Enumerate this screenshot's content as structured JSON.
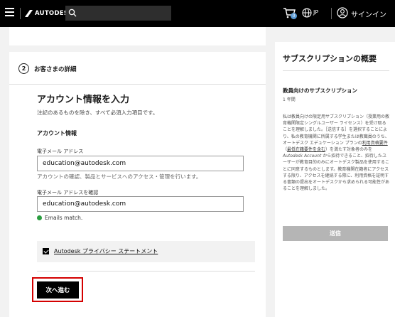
{
  "header": {
    "logo_text": "AUTODESK",
    "cart_count": "0",
    "language": "JP",
    "signin_label": "サインイン"
  },
  "step": {
    "number": "2",
    "label": "お客さまの詳細"
  },
  "account": {
    "title": "アカウント情報を入力",
    "subtitle": "注記のあるものを除き、すべて必須入力項目です。",
    "section_label": "アカウント情報",
    "email_label": "電子メール アドレス",
    "email_value": "education@autodesk.com",
    "email_hint": "アカウントの確認、製品とサービスへのアクセス・管理を行います。",
    "confirm_label": "電子メール アドレスを確認",
    "confirm_value": "education@autodesk.com",
    "match_text": "Emails match.",
    "privacy_link": "Autodesk プライバシー ステートメント",
    "next_button": "次へ進む"
  },
  "summary": {
    "title": "サブスクリプションの概要",
    "subtitle": "教員向けのサブスクリプション",
    "period": "1 年間",
    "body_1": "私は教員向けの限定用サブスクリプション（授業用の教育機関限定シングルユーザー ライセンス）を受け取ることを理解しました。［送信する］を選択することにより、私の教育機関に所属する学生または教職員のうち、オートデスク エデュケーション プランの",
    "body_link_1": "利用資格要件",
    "body_2": "（",
    "body_link_2": "最低在籍要件を含む",
    "body_3": "）を満たす対象者のみを ",
    "body_italic": "Autodesk Account",
    "body_4": " から招待できること、招待したユーザーが教育目的のみにオートデスク製品を使用することに同意するものとします。教育機関在籍者にアクセスする限り、アクセスを継続する際に、利用資格を証明する書類の提出をオートデスクから求められる可能性があることを理解しました。",
    "submit_button": "送信"
  },
  "colors": {
    "highlight": "#d40000",
    "match_green": "#2a9d3f",
    "cart_badge": "#5b9bd5"
  }
}
